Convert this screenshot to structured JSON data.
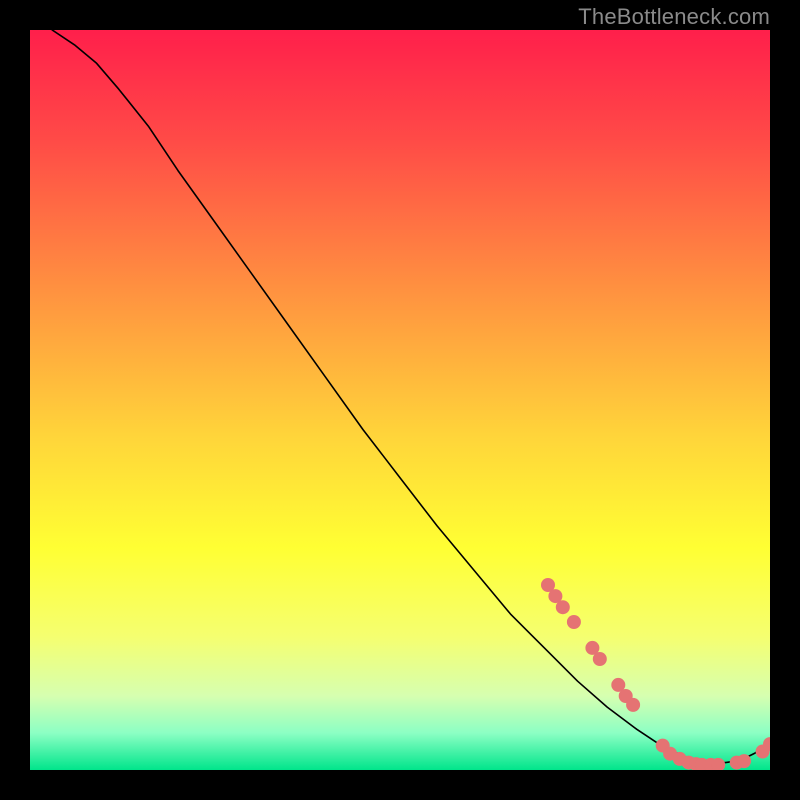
{
  "watermark": "TheBottleneck.com",
  "chart_data": {
    "type": "line",
    "title": "",
    "xlabel": "",
    "ylabel": "",
    "xlim": [
      0,
      100
    ],
    "ylim": [
      0,
      100
    ],
    "grid": false,
    "legend": false,
    "background_gradient": {
      "stops": [
        {
          "offset": 0.0,
          "color": "#ff1f4b"
        },
        {
          "offset": 0.15,
          "color": "#ff4b47"
        },
        {
          "offset": 0.35,
          "color": "#ff9140"
        },
        {
          "offset": 0.55,
          "color": "#ffd53a"
        },
        {
          "offset": 0.7,
          "color": "#ffff33"
        },
        {
          "offset": 0.82,
          "color": "#f5ff70"
        },
        {
          "offset": 0.9,
          "color": "#d6ffb0"
        },
        {
          "offset": 0.95,
          "color": "#8cffc4"
        },
        {
          "offset": 1.0,
          "color": "#00e58b"
        }
      ]
    },
    "series": [
      {
        "name": "curve",
        "stroke": "#000000",
        "stroke_width": 1.6,
        "x": [
          3,
          6,
          9,
          12,
          16,
          20,
          25,
          30,
          35,
          40,
          45,
          50,
          55,
          60,
          65,
          70,
          74,
          78,
          82,
          85,
          88,
          90,
          92,
          94,
          96,
          98,
          100
        ],
        "y": [
          100,
          98,
          95.5,
          92,
          87,
          81,
          74,
          67,
          60,
          53,
          46,
          39.5,
          33,
          27,
          21,
          16,
          12,
          8.5,
          5.5,
          3.5,
          2,
          1.3,
          1,
          1,
          1.3,
          2.3,
          4
        ]
      }
    ],
    "markers": {
      "name": "dots",
      "color": "#e57373",
      "radius": 7,
      "points": [
        {
          "x": 70.0,
          "y": 25.0
        },
        {
          "x": 71.0,
          "y": 23.5
        },
        {
          "x": 72.0,
          "y": 22.0
        },
        {
          "x": 73.5,
          "y": 20.0
        },
        {
          "x": 76.0,
          "y": 16.5
        },
        {
          "x": 77.0,
          "y": 15.0
        },
        {
          "x": 79.5,
          "y": 11.5
        },
        {
          "x": 80.5,
          "y": 10.0
        },
        {
          "x": 81.5,
          "y": 8.8
        },
        {
          "x": 85.5,
          "y": 3.3
        },
        {
          "x": 86.5,
          "y": 2.2
        },
        {
          "x": 87.8,
          "y": 1.5
        },
        {
          "x": 89.0,
          "y": 1.0
        },
        {
          "x": 90.0,
          "y": 0.8
        },
        {
          "x": 90.8,
          "y": 0.7
        },
        {
          "x": 92.0,
          "y": 0.7
        },
        {
          "x": 93.0,
          "y": 0.7
        },
        {
          "x": 95.5,
          "y": 1.0
        },
        {
          "x": 96.5,
          "y": 1.2
        },
        {
          "x": 99.0,
          "y": 2.5
        },
        {
          "x": 100.0,
          "y": 3.5
        }
      ]
    }
  }
}
